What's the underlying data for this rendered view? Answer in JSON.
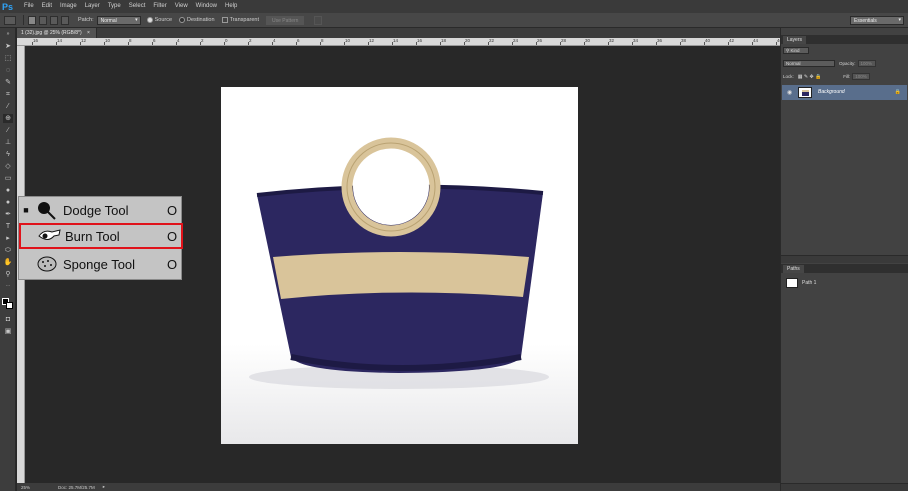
{
  "app": {
    "logo": "Ps"
  },
  "menu": [
    "File",
    "Edit",
    "Image",
    "Layer",
    "Type",
    "Select",
    "Filter",
    "View",
    "Window",
    "Help"
  ],
  "options": {
    "patch_label": "Patch:",
    "patch_value": "Normal",
    "source_label": "Source",
    "destination_label": "Destination",
    "transparent_label": "Transparent",
    "use_pattern_label": "Use Pattern",
    "workspace": "Essentials"
  },
  "document": {
    "tab_title": "1 (32).jpg @ 25% (RGB/8*)",
    "close": "×"
  },
  "ruler_top_labels": [
    "16",
    "14",
    "12",
    "10",
    "8",
    "6",
    "4",
    "2",
    "0",
    "2",
    "4",
    "6",
    "8",
    "10",
    "12",
    "14",
    "16",
    "18",
    "20",
    "22",
    "24",
    "26",
    "28",
    "30",
    "32",
    "34",
    "36",
    "38",
    "40",
    "42",
    "44",
    "46"
  ],
  "status": {
    "zoom": "25%",
    "doc": "Doc: 25.7M/25.7M"
  },
  "layers_panel": {
    "tab": "Layers",
    "kind_label": "Kind",
    "blend_mode": "Normal",
    "opacity_label": "Opacity:",
    "opacity_value": "100%",
    "lock_label": "Lock:",
    "fill_label": "Fill:",
    "fill_value": "100%",
    "layer_name": "Background"
  },
  "paths_panel": {
    "tab": "Paths",
    "path_name": "Path 1"
  },
  "flyout": {
    "items": [
      {
        "label": "Dodge Tool",
        "key": "O",
        "active": true
      },
      {
        "label": "Burn Tool",
        "key": "O",
        "active": false
      },
      {
        "label": "Sponge Tool",
        "key": "O",
        "active": false
      }
    ],
    "highlight_color": "#e0121a"
  },
  "colors": {
    "accent": "#2fa3f7",
    "selected_layer": "#596e8c",
    "bag_navy": "#2c2760",
    "bag_straw": "#d9c49a"
  }
}
